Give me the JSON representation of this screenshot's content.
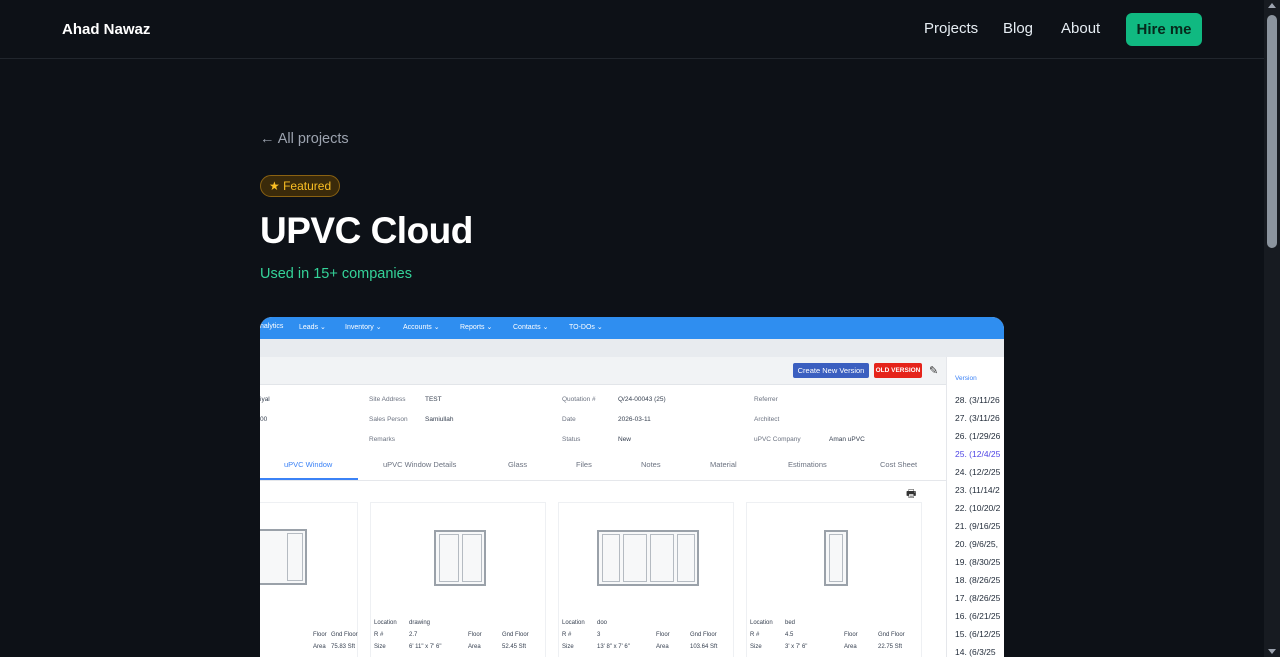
{
  "nav": {
    "brand": "Ahad Nawaz",
    "links": [
      "Projects",
      "Blog",
      "About"
    ],
    "cta": "Hire me"
  },
  "page": {
    "back_link": "← All projects",
    "badge": "★ Featured",
    "title": "UPVC Cloud",
    "subtitle": "Used in 15+ companies"
  },
  "colors": {
    "background": "#0d1117",
    "accent": "#10b981",
    "subtitle": "#34d399",
    "badge": "#fbbf24"
  },
  "screenshot": {
    "menu": [
      "nalytics",
      "Leads ⌄",
      "Inventory ⌄",
      "Accounts ⌄",
      "Reports ⌄",
      "Contacts ⌄",
      "TO-DOs ⌄"
    ],
    "buttons": {
      "create": "Create New Version",
      "old": "OLD VERSION"
    },
    "fields": {
      "site_address_label": "Site Address",
      "site_address": "TEST",
      "sales_person_label": "Sales Person",
      "sales_person": "Samiullah",
      "remarks_label": "Remarks",
      "quotation_label": "Quotation #",
      "quotation": "Q/24-00043 (25)",
      "date_label": "Date",
      "date": "2026-03-11",
      "status_label": "Status",
      "status": "New",
      "referrer_label": "Referrer",
      "architect_label": "Architect",
      "company_label": "uPVC Company",
      "company": "Aman uPVC",
      "left_top": "iyal",
      "left_mid": "00"
    },
    "tabs": [
      "uPVC Window",
      "uPVC Window Details",
      "Glass",
      "Files",
      "Notes",
      "Material",
      "Estimations",
      "Cost Sheet"
    ],
    "cards": [
      {
        "location": "",
        "r": "",
        "size": "",
        "floor": "Gnd Floor",
        "area": "75.83 Sft"
      },
      {
        "location": "drawing",
        "r": "2.7",
        "size": "6' 11\" x 7' 6\"",
        "floor": "Gnd Floor",
        "area": "52.45 Sft"
      },
      {
        "location": "doo",
        "r": "3",
        "size": "13' 8\" x 7' 6\"",
        "floor": "Gnd Floor",
        "area": "103.64 Sft"
      },
      {
        "location": "bed",
        "r": "4.5",
        "size": "3' x 7' 6\"",
        "floor": "Gnd Floor",
        "area": "22.75 Sft"
      }
    ],
    "labels": {
      "location": "Location",
      "r": "R #",
      "size": "Size",
      "floor": "Floor",
      "area": "Area"
    },
    "versions_header": "Version",
    "versions": [
      "28. (3/11/26",
      "27. (3/11/26",
      "26. (1/29/26",
      "25. (12/4/25",
      "24. (12/2/25",
      "23. (11/14/2",
      "22. (10/20/2",
      "21. (9/16/25",
      "20. (9/6/25,",
      "19. (8/30/25",
      "18. (8/26/25",
      "17. (8/26/25",
      "16. (6/21/25",
      "15. (6/12/25",
      "14. (6/3/25"
    ]
  }
}
